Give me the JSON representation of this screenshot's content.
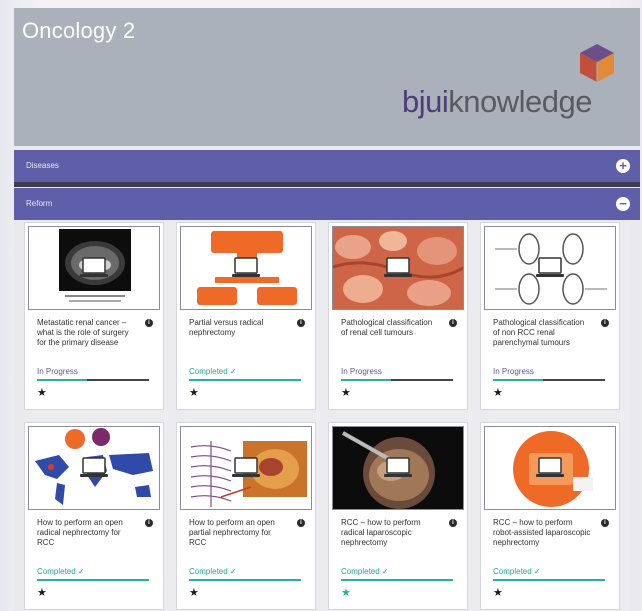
{
  "banner": {
    "title": "Oncology 2",
    "logo_part1": "bjui",
    "logo_part2": "knowledge"
  },
  "sections": [
    {
      "label": "Diseases",
      "toggle": "+"
    },
    {
      "label": "Reform",
      "toggle": "−"
    }
  ],
  "cards": [
    {
      "title": "Metastatic renal cancer – what is the role of surgery for the primary disease",
      "status": "In Progress",
      "progress": 0.45,
      "thumb": "ct-scan-icon",
      "star_color": "#1a1a1a"
    },
    {
      "title": "Partial versus radical nephrectomy",
      "status": "Completed ✓",
      "progress": 1.0,
      "thumb": "flowchart-icon",
      "star_color": "#1a1a1a"
    },
    {
      "title": "Pathological classification of renal cell tumours",
      "status": "In Progress",
      "progress": 0.45,
      "thumb": "histology-icon",
      "star_color": "#1a1a1a"
    },
    {
      "title": "Pathological classification of non RCC renal parenchymal tumours",
      "status": "In Progress",
      "progress": 0.45,
      "thumb": "kidney-diagram-icon",
      "star_color": "#1a1a1a"
    },
    {
      "title": "How to perform an open radical nephrectomy for RCC",
      "status": "Completed ✓",
      "progress": 1.0,
      "thumb": "world-map-icon",
      "star_color": "#1a1a1a"
    },
    {
      "title": "How to perform an open partial nephrectomy for RCC",
      "status": "Completed ✓",
      "progress": 1.0,
      "thumb": "anatomy-icon",
      "star_color": "#1a1a1a"
    },
    {
      "title": "RCC – how to perform radical laparoscopic nephrectomy",
      "status": "Completed ✓",
      "progress": 1.0,
      "thumb": "laparoscopy-icon",
      "star_color": "#22b3a6"
    },
    {
      "title": "RCC – how to perform robot-assisted laparoscopic nephrectomy",
      "status": "Completed ✓",
      "progress": 1.0,
      "thumb": "robot-icon",
      "star_color": "#1a1a1a"
    }
  ],
  "colors": {
    "banner_bg": "#aab1bb",
    "section_bar": "#5f5ea8",
    "completed": "#21a79b",
    "in_progress": "#5a5aa6",
    "logo_purple": "#4e3d7a"
  }
}
